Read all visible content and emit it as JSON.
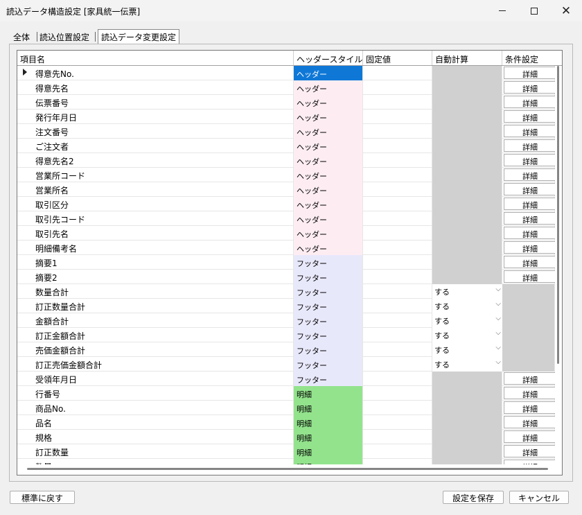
{
  "window": {
    "title": "読込データ構造設定 [家具統一伝票]"
  },
  "tabs": [
    {
      "label": "全体"
    },
    {
      "label": "読込位置設定"
    },
    {
      "label": "読込データ変更設定"
    }
  ],
  "grid": {
    "headers": {
      "name": "項目名",
      "style": "ヘッダースタイル",
      "fixed": "固定値",
      "auto": "自動計算",
      "cond": "条件設定"
    },
    "detail_label": "詳細",
    "rows": [
      {
        "name": "得意先No.",
        "style": "ヘッダー",
        "kind": "sel",
        "auto": "",
        "cond": "詳細"
      },
      {
        "name": "得意先名",
        "style": "ヘッダー",
        "kind": "h",
        "auto": "",
        "cond": "詳細"
      },
      {
        "name": "伝票番号",
        "style": "ヘッダー",
        "kind": "h",
        "auto": "",
        "cond": "詳細"
      },
      {
        "name": "発行年月日",
        "style": "ヘッダー",
        "kind": "h",
        "auto": "",
        "cond": "詳細"
      },
      {
        "name": "注文番号",
        "style": "ヘッダー",
        "kind": "h",
        "auto": "",
        "cond": "詳細"
      },
      {
        "name": "ご注文者",
        "style": "ヘッダー",
        "kind": "h",
        "auto": "",
        "cond": "詳細"
      },
      {
        "name": "得意先名2",
        "style": "ヘッダー",
        "kind": "h",
        "auto": "",
        "cond": "詳細"
      },
      {
        "name": "営業所コード",
        "style": "ヘッダー",
        "kind": "h",
        "auto": "",
        "cond": "詳細"
      },
      {
        "name": "営業所名",
        "style": "ヘッダー",
        "kind": "h",
        "auto": "",
        "cond": "詳細"
      },
      {
        "name": "取引区分",
        "style": "ヘッダー",
        "kind": "h",
        "auto": "",
        "cond": "詳細"
      },
      {
        "name": "取引先コード",
        "style": "ヘッダー",
        "kind": "h",
        "auto": "",
        "cond": "詳細"
      },
      {
        "name": "取引先名",
        "style": "ヘッダー",
        "kind": "h",
        "auto": "",
        "cond": "詳細"
      },
      {
        "name": "明細備考名",
        "style": "ヘッダー",
        "kind": "h",
        "auto": "",
        "cond": "詳細"
      },
      {
        "name": "摘要1",
        "style": "フッター",
        "kind": "f",
        "auto": "",
        "cond": "詳細"
      },
      {
        "name": "摘要2",
        "style": "フッター",
        "kind": "f",
        "auto": "",
        "cond": "詳細"
      },
      {
        "name": "数量合計",
        "style": "フッター",
        "kind": "f",
        "auto": "する",
        "cond": ""
      },
      {
        "name": "訂正数量合計",
        "style": "フッター",
        "kind": "f",
        "auto": "する",
        "cond": ""
      },
      {
        "name": "金額合計",
        "style": "フッター",
        "kind": "f",
        "auto": "する",
        "cond": ""
      },
      {
        "name": "訂正金額合計",
        "style": "フッター",
        "kind": "f",
        "auto": "する",
        "cond": ""
      },
      {
        "name": "売価金額合計",
        "style": "フッター",
        "kind": "f",
        "auto": "する",
        "cond": ""
      },
      {
        "name": "訂正売価金額合計",
        "style": "フッター",
        "kind": "f",
        "auto": "する",
        "cond": ""
      },
      {
        "name": "受領年月日",
        "style": "フッター",
        "kind": "f",
        "auto": "",
        "cond": "詳細"
      },
      {
        "name": "行番号",
        "style": "明細",
        "kind": "m",
        "auto": "",
        "cond": "詳細"
      },
      {
        "name": "商品No.",
        "style": "明細",
        "kind": "m",
        "auto": "",
        "cond": "詳細"
      },
      {
        "name": "品名",
        "style": "明細",
        "kind": "m",
        "auto": "",
        "cond": "詳細"
      },
      {
        "name": "規格",
        "style": "明細",
        "kind": "m",
        "auto": "",
        "cond": "詳細"
      },
      {
        "name": "訂正数量",
        "style": "明細",
        "kind": "m",
        "auto": "",
        "cond": "詳細"
      },
      {
        "name": "数量",
        "style": "明細",
        "kind": "m",
        "auto": "",
        "cond": "詳細"
      }
    ]
  },
  "buttons": {
    "reset": "標準に戻す",
    "save": "設定を保存",
    "cancel": "キャンセル"
  }
}
